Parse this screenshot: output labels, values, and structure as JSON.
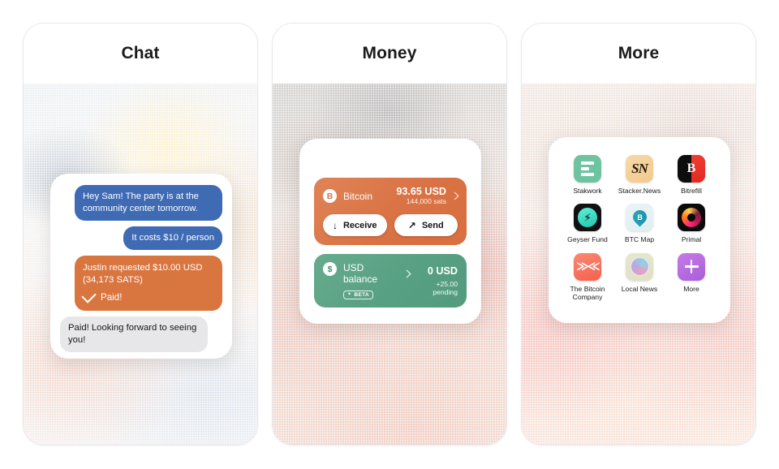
{
  "cards": [
    {
      "title": "Chat"
    },
    {
      "title": "Money"
    },
    {
      "title": "More"
    }
  ],
  "chat": {
    "messages": [
      {
        "id": "msg-invite",
        "text": "Hey Sam! The party is at the community center tomorrow.",
        "style": "blue"
      },
      {
        "id": "msg-cost",
        "text": "It costs $10 / person",
        "style": "blue"
      },
      {
        "id": "msg-request",
        "text": "Justin requested $10.00 USD (34,173 SATS)",
        "style": "orange",
        "status": "Paid!"
      },
      {
        "id": "msg-reply",
        "text": "Paid! Looking forward to seeing you!",
        "style": "grey"
      }
    ]
  },
  "money": {
    "bitcoin": {
      "icon_glyph": "B",
      "name": "Bitcoin",
      "fiat_amount": "93.65 USD",
      "sats_amount": "144,000 sats",
      "receive_label": "Receive",
      "receive_arrow": "↓",
      "send_label": "Send",
      "send_arrow": "↗"
    },
    "usd": {
      "icon_glyph": "$",
      "label": "USD balance",
      "badge": "BETA",
      "badge_icon": "✦",
      "amount": "0 USD",
      "pending": "+25.00 pending"
    },
    "colors": {
      "bitcoin_card": "#d97244",
      "usd_card": "#58a083",
      "chat_blue": "#3f6ab4",
      "chat_grey": "#e7e7e9"
    }
  },
  "more": {
    "apps": [
      {
        "name": "Stakwork",
        "icon": "stakwork-icon"
      },
      {
        "name": "Stacker.News",
        "icon": "stacker-news-icon"
      },
      {
        "name": "Bitrefill",
        "icon": "bitrefill-icon"
      },
      {
        "name": "Geyser Fund",
        "icon": "geyser-fund-icon"
      },
      {
        "name": "BTC Map",
        "icon": "btc-map-icon"
      },
      {
        "name": "Primal",
        "icon": "primal-icon"
      },
      {
        "name": "The Bitcoin Company",
        "icon": "the-bitcoin-company-icon"
      },
      {
        "name": "Local News",
        "icon": "local-news-icon"
      },
      {
        "name": "More",
        "icon": "more-plus-icon"
      }
    ]
  }
}
